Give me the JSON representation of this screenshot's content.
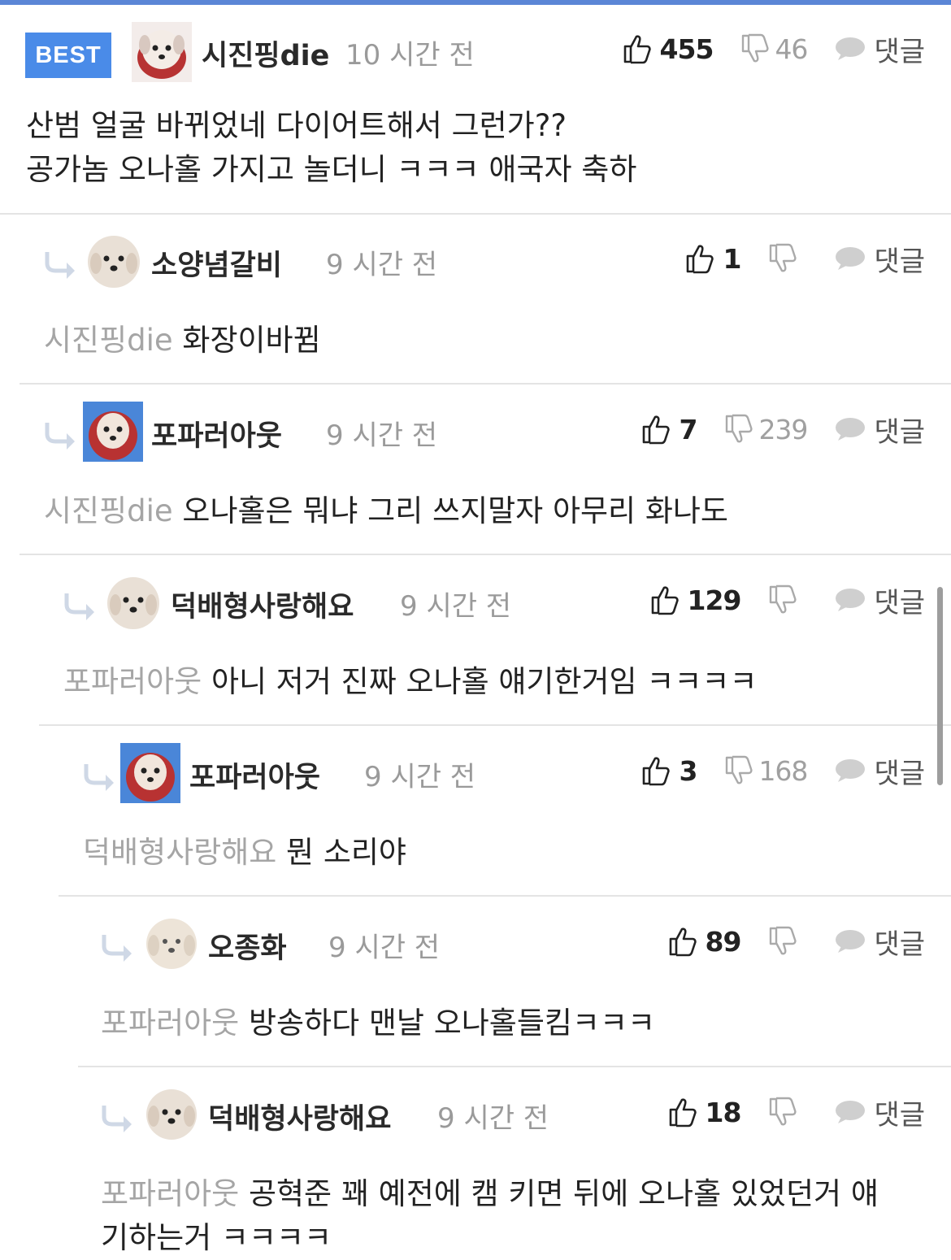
{
  "best_label": "BEST",
  "reply_label": "댓글",
  "colors": {
    "accent": "#5b86d6",
    "best_badge": "#4a8be8",
    "mention": "#a5a5a5"
  },
  "comments": [
    {
      "nick": "시진핑die",
      "time": "10 시간 전",
      "likes": "455",
      "dislikes": "46",
      "lines": [
        "산범 얼굴 바뀌었네 다이어트해서 그런가??",
        "공가놈 오나홀 가지고 놀더니 ㅋㅋㅋ 애국자 축하"
      ]
    },
    {
      "nick": "소양념갈비",
      "time": "9 시간 전",
      "likes": "1",
      "dislikes": "",
      "mention": "시진핑die",
      "text": "화장이바뀜"
    },
    {
      "nick": "포파러아웃",
      "time": "9 시간 전",
      "likes": "7",
      "dislikes": "239",
      "mention": "시진핑die",
      "text": "오나홀은 뭐냐 그리 쓰지말자 아무리 화나도"
    },
    {
      "nick": "덕배형사랑해요",
      "time": "9 시간 전",
      "likes": "129",
      "dislikes": "",
      "mention": "포파러아웃",
      "text": "아니 저거 진짜 오나홀 얘기한거임 ㅋㅋㅋㅋ"
    },
    {
      "nick": "포파러아웃",
      "time": "9 시간 전",
      "likes": "3",
      "dislikes": "168",
      "mention": "덕배형사랑해요",
      "text": "뭔 소리야"
    },
    {
      "nick": "오종화",
      "time": "9 시간 전",
      "likes": "89",
      "dislikes": "",
      "mention": "포파러아웃",
      "text": "방송하다 맨날 오나홀들킴ㅋㅋㅋ"
    },
    {
      "nick": "덕배형사랑해요",
      "time": "9 시간 전",
      "likes": "18",
      "dislikes": "",
      "mention": "포파러아웃",
      "text": "공혁준 꽤 예전에 캠 키면 뒤에 오나홀 있었던거 얘",
      "text2": "기하는거 ㅋㅋㅋㅋ"
    }
  ]
}
